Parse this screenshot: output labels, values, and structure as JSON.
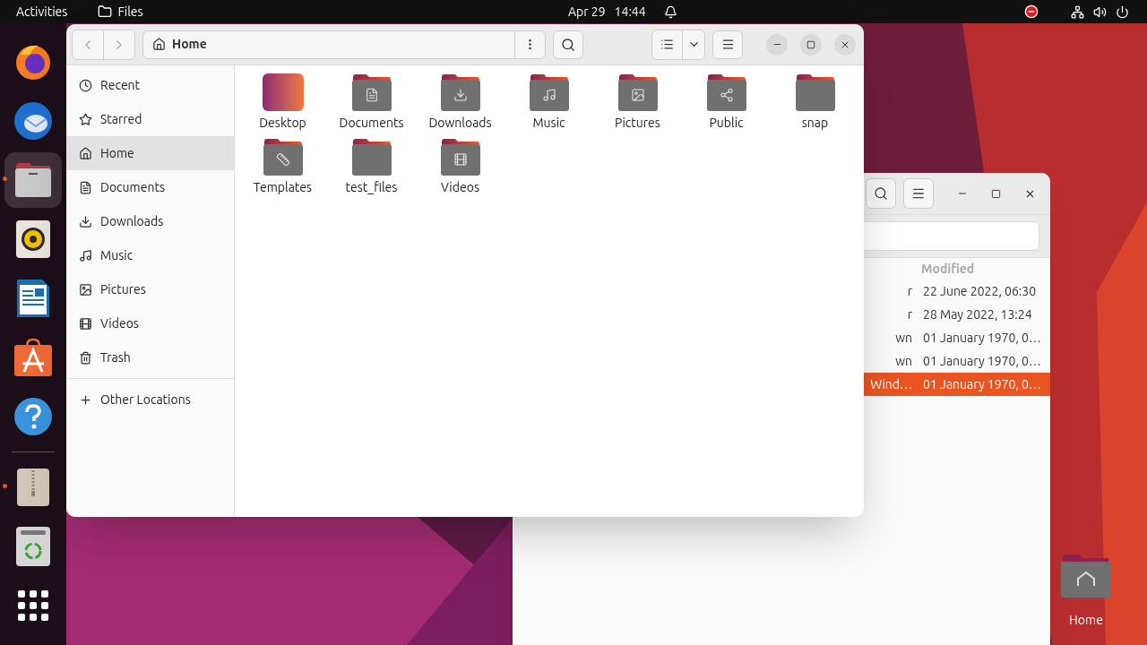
{
  "top_bar": {
    "activities": "Activities",
    "app": "Files",
    "date": "Apr 29",
    "time": "14:44"
  },
  "dock": [
    {
      "kind": "firefox",
      "running": false,
      "selected": false
    },
    {
      "kind": "thunderbird",
      "running": false,
      "selected": false
    },
    {
      "kind": "files",
      "running": true,
      "selected": true
    },
    {
      "kind": "rhythmbox",
      "running": false,
      "selected": false
    },
    {
      "kind": "writer",
      "running": false,
      "selected": false
    },
    {
      "kind": "software",
      "running": false,
      "selected": false
    },
    {
      "kind": "help",
      "running": false,
      "selected": false
    },
    {
      "kind": "separator"
    },
    {
      "kind": "archive",
      "running": true,
      "selected": false
    },
    {
      "kind": "trash",
      "running": false,
      "selected": false
    },
    {
      "kind": "apps",
      "running": false,
      "selected": false
    }
  ],
  "files_window": {
    "path": "Home",
    "sidebar": [
      {
        "label": "Recent",
        "kind": "recent",
        "selected": false
      },
      {
        "label": "Starred",
        "kind": "star",
        "selected": false
      },
      {
        "label": "Home",
        "kind": "home",
        "selected": true
      },
      {
        "label": "Documents",
        "kind": "document",
        "selected": false
      },
      {
        "label": "Downloads",
        "kind": "download",
        "selected": false
      },
      {
        "label": "Music",
        "kind": "music",
        "selected": false
      },
      {
        "label": "Pictures",
        "kind": "picture",
        "selected": false
      },
      {
        "label": "Videos",
        "kind": "video",
        "selected": false
      },
      {
        "label": "Trash",
        "kind": "trash",
        "selected": false
      }
    ],
    "other_locations": "Other Locations",
    "folders": [
      {
        "label": "Desktop",
        "kind": "desktop"
      },
      {
        "label": "Documents",
        "kind": "document"
      },
      {
        "label": "Downloads",
        "kind": "download"
      },
      {
        "label": "Music",
        "kind": "music"
      },
      {
        "label": "Pictures",
        "kind": "picture"
      },
      {
        "label": "Public",
        "kind": "share"
      },
      {
        "label": "snap",
        "kind": "plain"
      },
      {
        "label": "Templates",
        "kind": "template"
      },
      {
        "label": "test_files",
        "kind": "plain"
      },
      {
        "label": "Videos",
        "kind": "video"
      }
    ]
  },
  "back_window": {
    "column_header": "Modified",
    "rows": [
      {
        "column_1": "r",
        "modified": "22 June 2022, 06:30",
        "selected": false
      },
      {
        "column_1": "r",
        "modified": "28 May 2022, 13:24",
        "selected": false
      },
      {
        "column_1": "wn",
        "modified": "01 January 1970, 0…",
        "selected": false
      },
      {
        "column_1": "wn",
        "modified": "01 January 1970, 0…",
        "selected": false
      },
      {
        "column_1": "Wind…",
        "modified": "01 January 1970, 0…",
        "selected": true
      }
    ]
  },
  "desktop_icons": [
    {
      "label": "Home"
    }
  ]
}
